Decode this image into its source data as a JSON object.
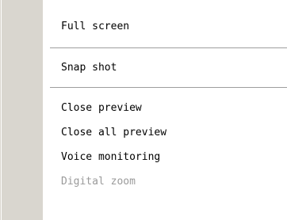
{
  "menu": {
    "items": [
      {
        "label": "Full screen",
        "enabled": true
      },
      {
        "label": "Snap shot",
        "enabled": true
      },
      {
        "label": "Close preview",
        "enabled": true
      },
      {
        "label": "Close all preview",
        "enabled": true
      },
      {
        "label": "Voice monitoring",
        "enabled": true
      },
      {
        "label": "Digital zoom",
        "enabled": false
      }
    ]
  }
}
